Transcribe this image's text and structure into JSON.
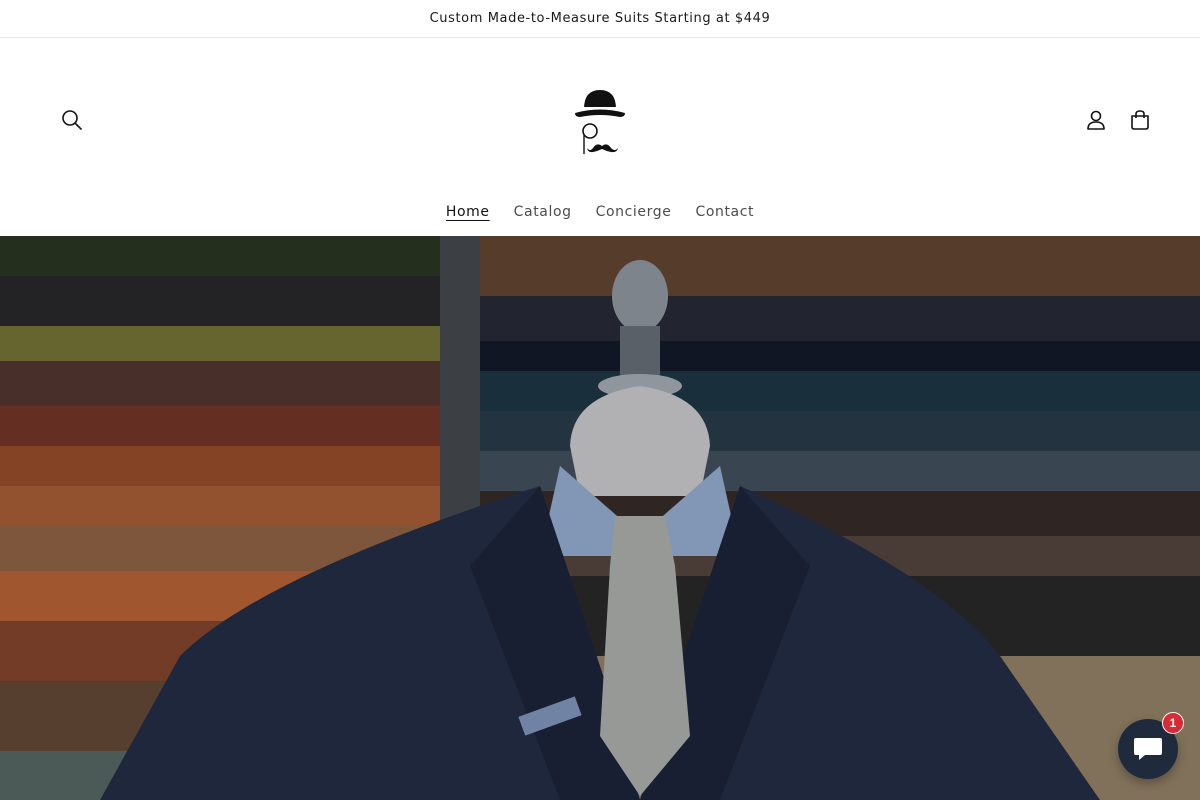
{
  "announcement": {
    "text": "Custom Made-to-Measure Suits Starting at $449"
  },
  "header": {
    "logo_icon": "bowler-hat-mustache-logo",
    "search_icon": "search-icon",
    "account_icon": "user-icon",
    "cart_icon": "shopping-bag-icon"
  },
  "nav": {
    "items": [
      {
        "label": "Home",
        "active": true
      },
      {
        "label": "Catalog",
        "active": false
      },
      {
        "label": "Concierge",
        "active": false
      },
      {
        "label": "Contact",
        "active": false
      }
    ]
  },
  "hero": {
    "image": "tailor mannequin wearing navy double-breasted suit, light blue shirt and silver tie in front of fabric shelves"
  },
  "chat": {
    "icon": "chat-bubble-icon",
    "badge_count": "1",
    "badge_color": "#d72b36",
    "button_color": "#1f2b3d"
  }
}
